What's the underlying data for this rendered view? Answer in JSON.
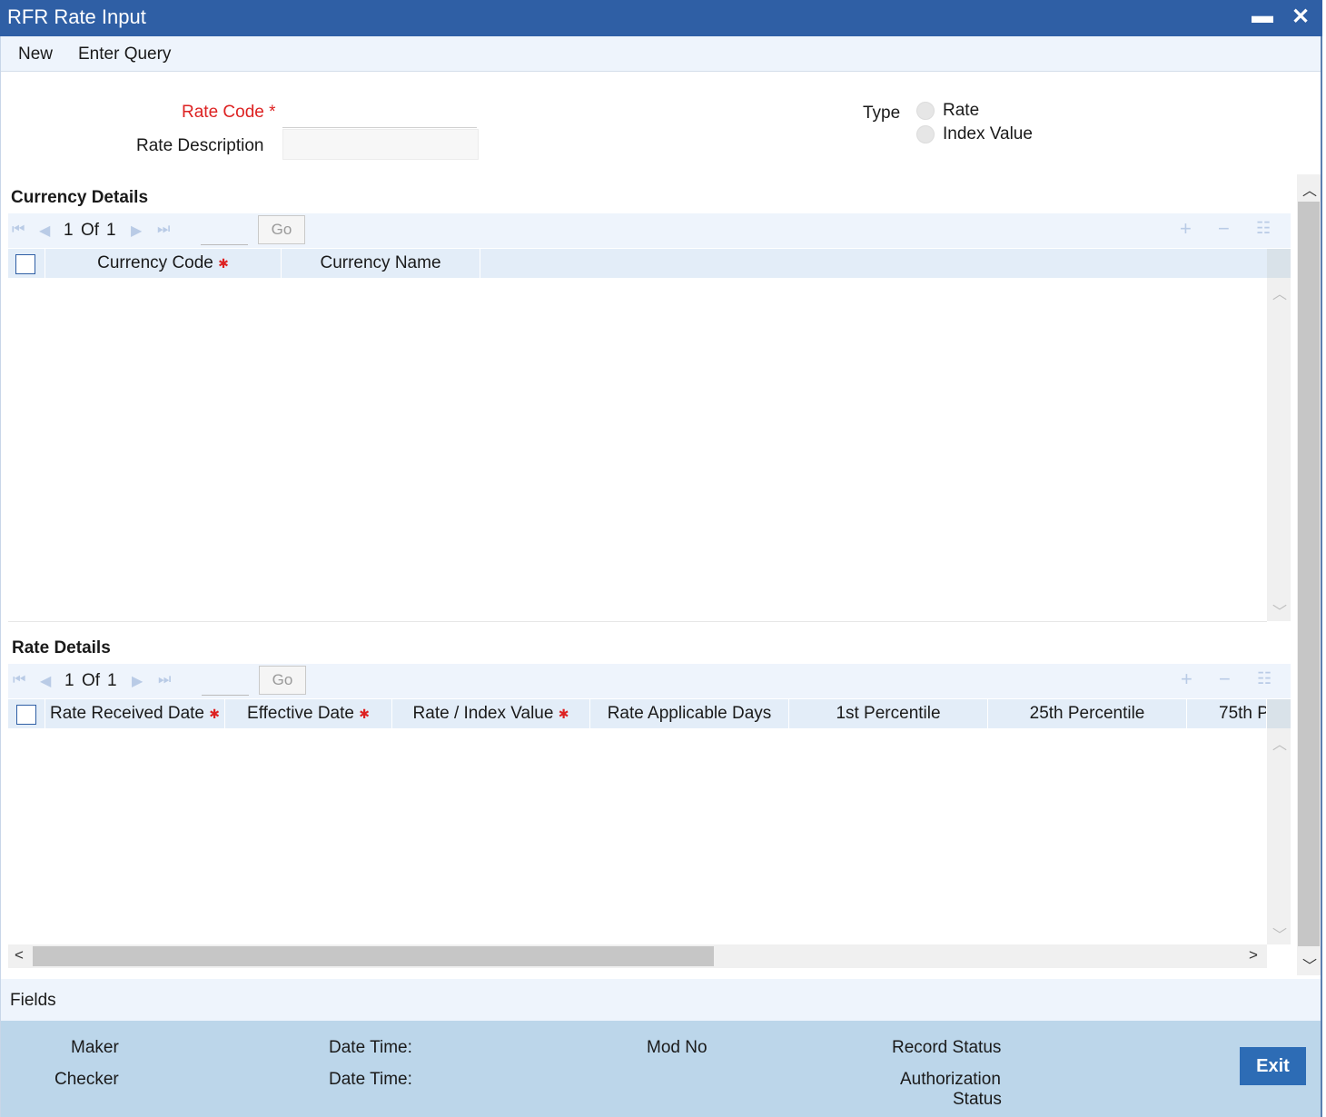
{
  "window": {
    "title": "RFR Rate Input",
    "minimize_glyph": "▬",
    "close_glyph": "✕"
  },
  "menu": {
    "new": "New",
    "enter_query": "Enter Query"
  },
  "form": {
    "rate_code_label": "Rate Code",
    "required_mark": "*",
    "rate_code_value": "",
    "rate_description_label": "Rate Description",
    "rate_description_value": "",
    "type_label": "Type",
    "type_options": [
      "Rate",
      "Index Value"
    ]
  },
  "currency_details": {
    "title": "Currency Details",
    "pager": {
      "current": "1",
      "of": "Of",
      "total": "1",
      "go": "Go"
    },
    "columns": [
      "Currency Code",
      "Currency Name"
    ],
    "rows": []
  },
  "rate_details": {
    "title": "Rate Details",
    "pager": {
      "current": "1",
      "of": "Of",
      "total": "1",
      "go": "Go"
    },
    "columns": [
      "Rate Received Date",
      "Effective Date",
      "Rate / Index Value",
      "Rate Applicable Days",
      "1st Percentile",
      "25th Percentile",
      "75th P"
    ],
    "rows": []
  },
  "fields_label": "Fields",
  "footer": {
    "maker": "Maker",
    "checker": "Checker",
    "date_time_1": "Date Time:",
    "date_time_2": "Date Time:",
    "mod_no": "Mod No",
    "record_status": "Record Status",
    "authorization": "Authorization",
    "status": "Status",
    "exit": "Exit"
  },
  "icons": {
    "first": "first-page-icon",
    "prev": "prev-page-icon",
    "next": "next-page-icon",
    "last": "last-page-icon",
    "add": "add-row-icon",
    "remove": "remove-row-icon",
    "columns": "column-menu-icon"
  },
  "colors": {
    "titlebar": "#2f5fa5",
    "footer": "#bcd6ea",
    "exit_button": "#2d6cb5",
    "required": "#dd2222"
  }
}
